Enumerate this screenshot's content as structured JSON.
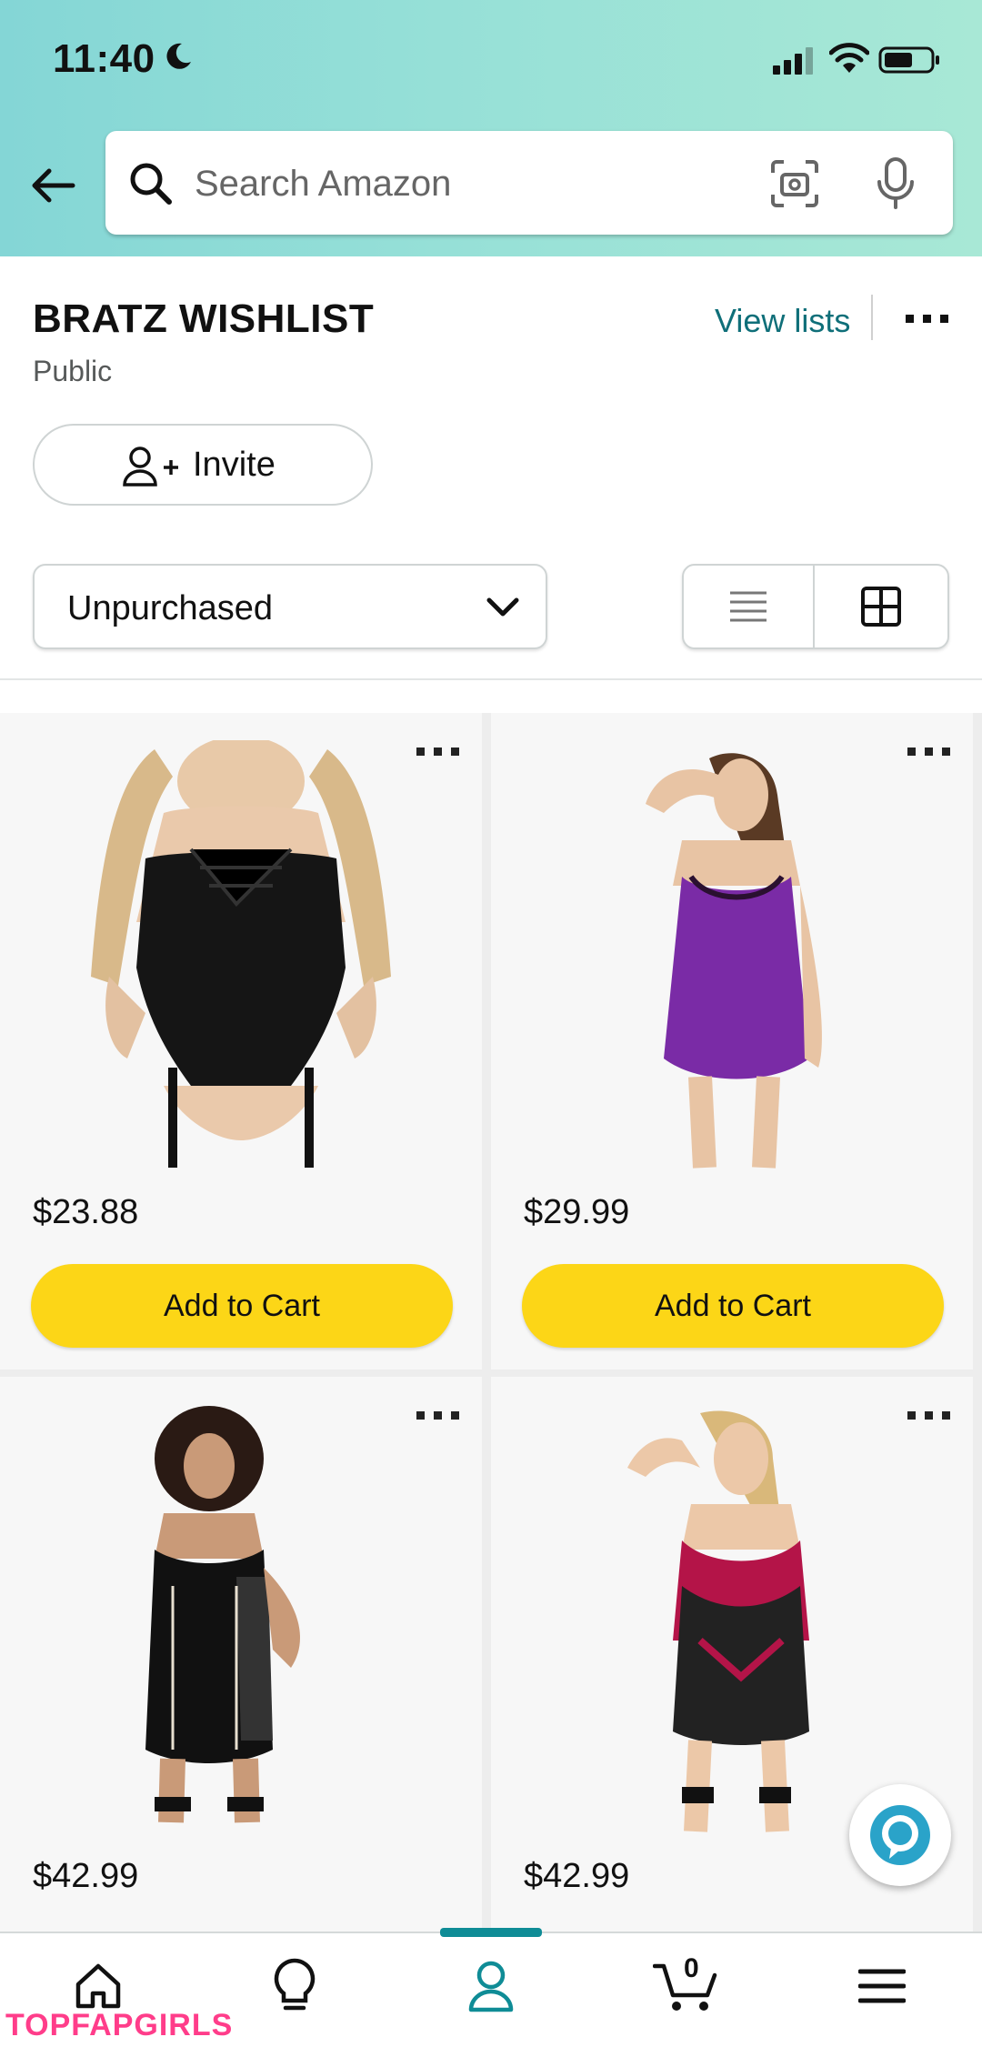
{
  "status_bar": {
    "time": "11:40"
  },
  "search": {
    "placeholder": "Search Amazon"
  },
  "list": {
    "title": "BRATZ WISHLIST",
    "visibility": "Public",
    "view_lists": "View lists",
    "invite_label": "Invite",
    "filter_value": "Unpurchased"
  },
  "products": [
    {
      "price": "$23.88",
      "cart_label": "Add to Cart"
    },
    {
      "price": "$29.99",
      "cart_label": "Add to Cart"
    },
    {
      "price": "$42.99"
    },
    {
      "price": "$42.99"
    }
  ],
  "nav": {
    "items": [
      "home-icon",
      "lightbulb-icon",
      "account-icon",
      "cart-icon",
      "menu-icon"
    ],
    "cart_count": "0",
    "active": "account-icon"
  },
  "watermark": "TOPFAPGIRLS",
  "colors": {
    "header_gradient_start": "#84d6d6",
    "header_gradient_end": "#a8e8d6",
    "accent_link": "#0f6f79",
    "cart_button": "#fcd617",
    "active_tab": "#0f8c96"
  }
}
